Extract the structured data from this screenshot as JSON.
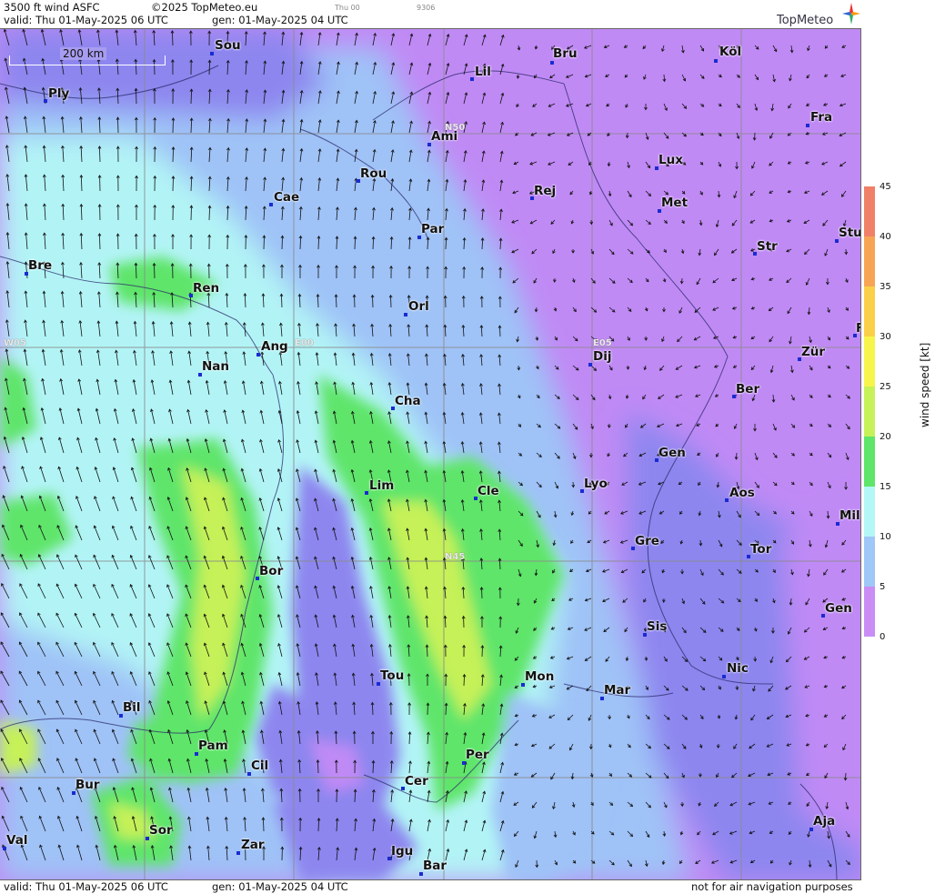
{
  "header": {
    "line1_title": "3500 ft wind ASFC",
    "line1_copyright": "©2025 TopMeteo.eu",
    "line1_day": "Thu 00",
    "line1_code": "9306",
    "line2_valid": "valid:  Thu  01-May-2025  06 UTC",
    "line2_gen": "gen:  01-May-2025 04 UTC"
  },
  "footer": {
    "valid": "valid:  Thu  01-May-2025  06 UTC",
    "gen": "gen:  01-May-2025 04 UTC",
    "disclaimer": "not for air navigation purposes"
  },
  "logo": {
    "text": "TopMeteo",
    "icon": "compass-star-icon"
  },
  "scale": {
    "label": "200 km"
  },
  "grid_labels": [
    "N50",
    "N45",
    "W05",
    "E00",
    "E05"
  ],
  "legend": {
    "title": "wind speed [kt]",
    "ticks": [
      "45",
      "40",
      "35",
      "30",
      "25",
      "20",
      "15",
      "10",
      "5",
      "0"
    ],
    "colors": [
      "#f08068",
      "#f7a555",
      "#fbd049",
      "#f7f54c",
      "#c6f158",
      "#5fe56a",
      "#b3f7f7",
      "#9fc7f7",
      "#8f8ef5",
      "#c98df5"
    ]
  },
  "cities": [
    "Sou",
    "Ply",
    "Lil",
    "Bru",
    "Köl",
    "Ami",
    "Fra",
    "Rou",
    "Cae",
    "Lux",
    "Rej",
    "Met",
    "Par",
    "Stu",
    "Bre",
    "Str",
    "Ren",
    "Orl",
    "Ang",
    "Nan",
    "Dij",
    "Zür",
    "Ber",
    "Cha",
    "Gen",
    "Lim",
    "Cle",
    "Lyo",
    "Aos",
    "Mil",
    "Gre",
    "Tor",
    "Bor",
    "Gen",
    "Sis",
    "Tou",
    "Mon",
    "Mar",
    "Nic",
    "Bil",
    "Pam",
    "Cil",
    "Per",
    "Cer",
    "Bur",
    "Sor",
    "Aja",
    "Val",
    "Zar",
    "Igu",
    "Bar",
    "F"
  ]
}
